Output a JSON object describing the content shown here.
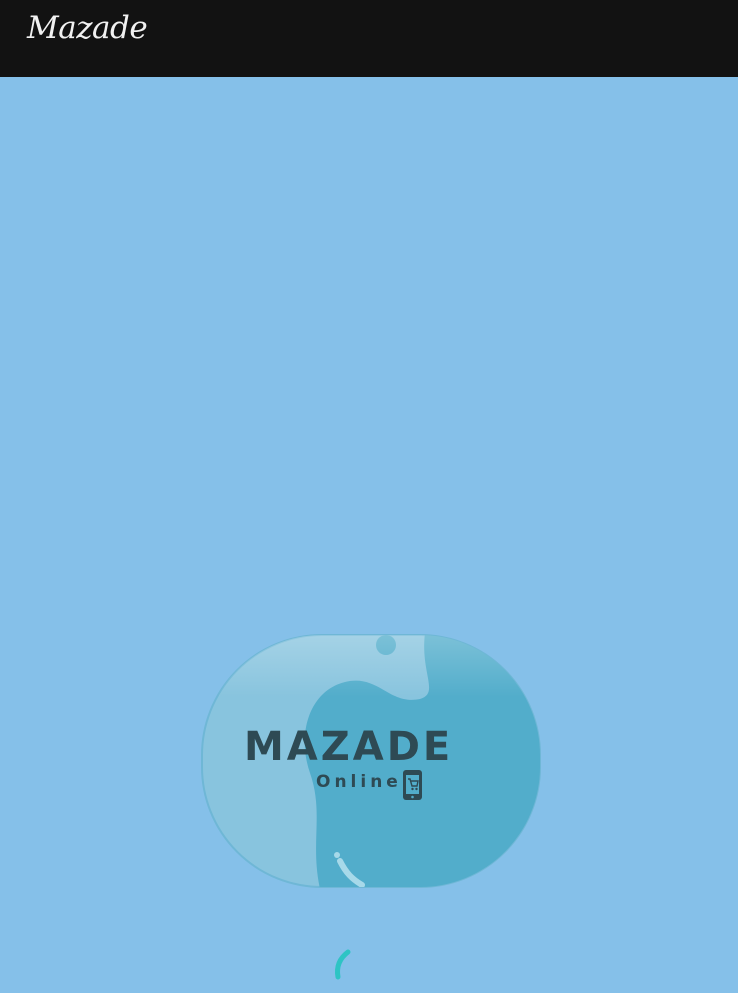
{
  "app_bar": {
    "title": "Mazade"
  },
  "splash": {
    "logo_word": "MAZADE",
    "logo_subtitle": "Online",
    "logo_icon": "mobile-cart-icon"
  },
  "loading": {
    "indicator": "spinner-icon"
  },
  "colors": {
    "app_bar": "#121212",
    "background": "#85c0e9",
    "logo_light": "#86c4df",
    "logo_dark": "#52adcb",
    "logo_text": "#2e4a54",
    "spinner": "#2ec4c4"
  }
}
